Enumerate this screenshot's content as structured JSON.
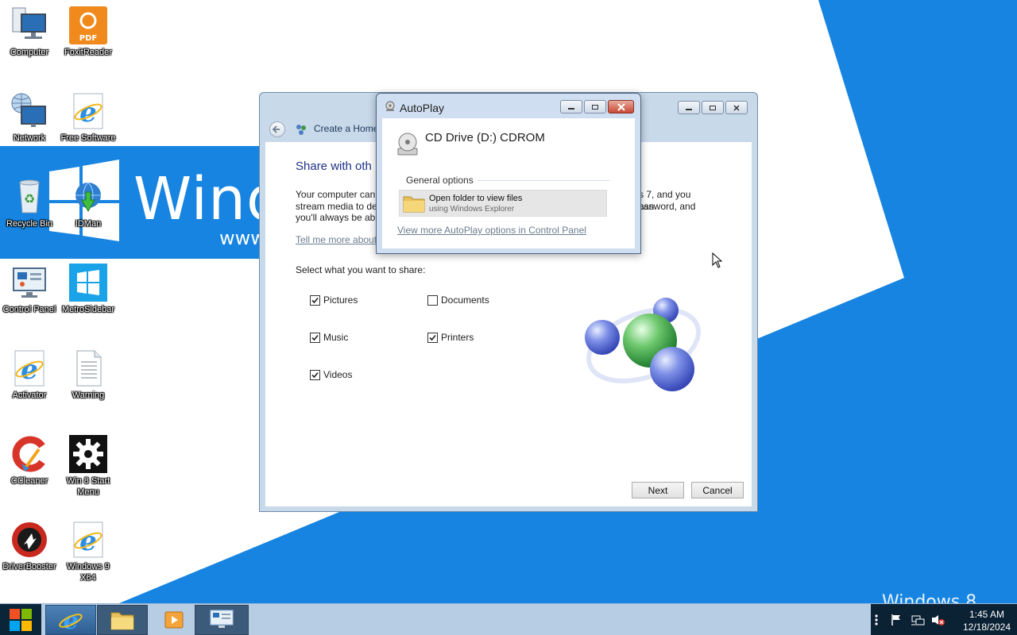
{
  "desktop": {
    "wallpaper": {
      "brand_text": "Wind",
      "url_text": "www",
      "corner_text": "Windows 8",
      "colors": {
        "blue": "#1684e0",
        "white": "#ffffff"
      }
    },
    "icons": [
      {
        "label": "Computer",
        "icon": "computer-icon"
      },
      {
        "label": "FoxitReader",
        "icon": "foxit-pdf-icon"
      },
      {
        "label": "Network",
        "icon": "network-icon"
      },
      {
        "label": "Free Software",
        "icon": "internet-explorer-icon"
      },
      {
        "label": "Recycle Bin",
        "icon": "recycle-bin-icon"
      },
      {
        "label": "IDMan",
        "icon": "idm-icon"
      },
      {
        "label": "Control Panel",
        "icon": "control-panel-icon"
      },
      {
        "label": "MetroSidebar",
        "icon": "metro-sidebar-icon"
      },
      {
        "label": "Activator",
        "icon": "internet-explorer-icon"
      },
      {
        "label": "Warning",
        "icon": "text-document-icon"
      },
      {
        "label": "CCleaner",
        "icon": "ccleaner-icon"
      },
      {
        "label": "Win 8 Start Menu",
        "icon": "gear-icon"
      },
      {
        "label": "DriverBooster",
        "icon": "driver-booster-icon"
      },
      {
        "label": "Windows 9 X64",
        "icon": "internet-explorer-icon"
      }
    ]
  },
  "wizard": {
    "nav_title": "Create a Home",
    "heading": "Share with oth",
    "description": "Your computer can                                                                                   s 7, and you can stream media to de                                                                                    assword, and you'll always be abl",
    "desc_lines": [
      {
        "left": "Your computer can",
        "right": "s 7, and you can"
      },
      {
        "left": "stream media to de",
        "right": "assword, and"
      },
      {
        "left": "you'll always be abl",
        "right": ""
      }
    ],
    "help_link": "Tell me more about",
    "select_label": "Select what you want to share:",
    "share_items": [
      {
        "label": "Pictures",
        "checked": true
      },
      {
        "label": "Documents",
        "checked": false
      },
      {
        "label": "Music",
        "checked": true
      },
      {
        "label": "Printers",
        "checked": true
      },
      {
        "label": "Videos",
        "checked": true
      }
    ],
    "buttons": {
      "next": "Next",
      "cancel": "Cancel"
    }
  },
  "autoplay": {
    "title": "AutoPlay",
    "drive": "CD Drive (D:) CDROM",
    "section": "General options",
    "option_title": "Open folder to view files",
    "option_subtitle": "using Windows Explorer",
    "more_link": "View more AutoPlay options in Control Panel"
  },
  "taskbar": {
    "pinned": [
      "internet-explorer-icon",
      "file-explorer-icon",
      "media-player-icon",
      "control-panel-icon"
    ],
    "tray_icons": [
      "show-more-icon",
      "flag-icon",
      "network-icon",
      "volume-muted-icon"
    ],
    "time": "1:45 AM",
    "date": "12/18/2024"
  }
}
